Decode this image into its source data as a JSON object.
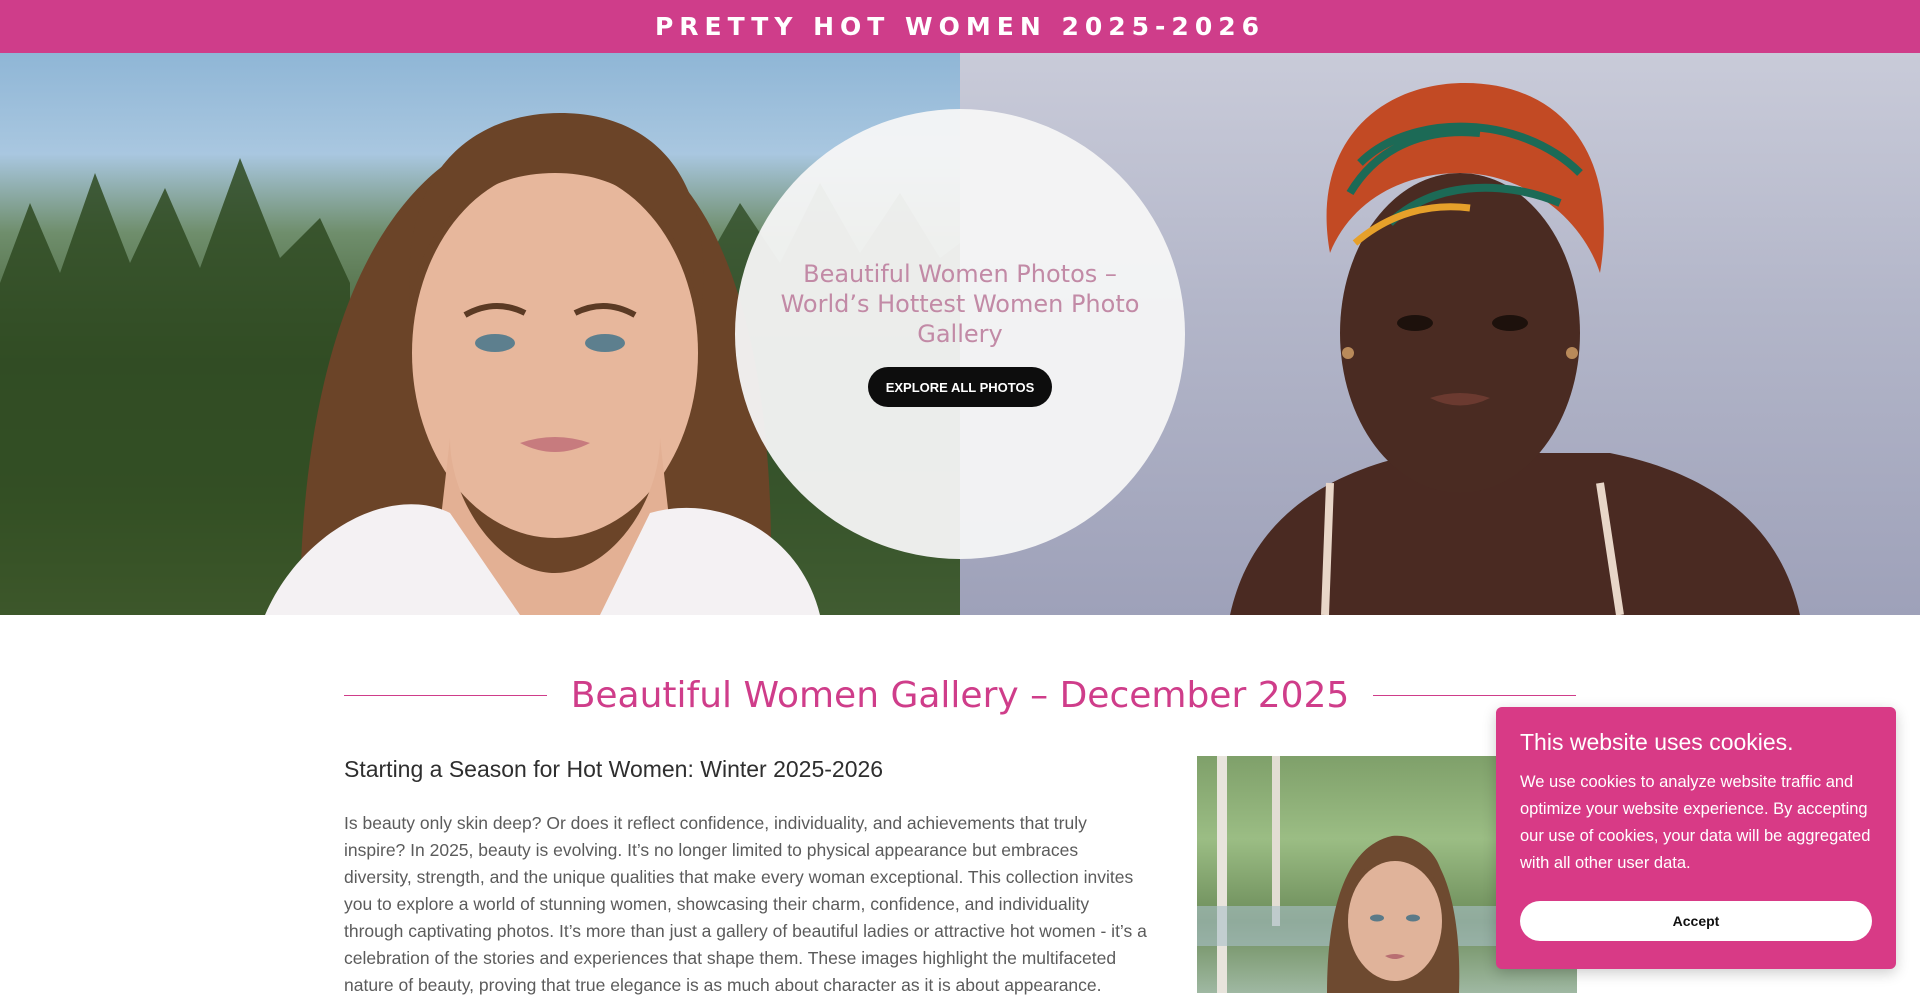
{
  "header": {
    "site_title": "PRETTY HOT WOMEN 2025-2026"
  },
  "hero": {
    "heading": "Beautiful Women Photos – World’s Hottest Women Photo Gallery",
    "cta_label": "EXPLORE ALL PHOTOS",
    "left_photo_icon": "woman-portrait-forest-photo",
    "right_photo_icon": "woman-portrait-headwrap-photo"
  },
  "main": {
    "section_title": "Beautiful Women Gallery – December 2025",
    "subheading": "Starting a Season for Hot Women: Winter 2025-2026",
    "paragraph": "Is beauty only skin deep? Or does it reflect confidence, individuality, and achievements that truly inspire? In 2025, beauty is evolving. It’s no longer limited to physical appearance but embraces diversity, strength, and the unique qualities that make every woman exceptional. This collection invites you to explore a world of stunning women, showcasing their charm, confidence, and individuality through captivating photos. It’s more than just a gallery of beautiful ladies or attractive hot women - it’s a celebration of the stories and experiences that shape them. These images highlight the multifaceted nature of beauty, proving that true elegance is as much about character as it is about appearance.",
    "side_photo_icon": "woman-portrait-birch-lake-photo"
  },
  "cookie_banner": {
    "title": "This website uses cookies.",
    "text": "We use cookies to analyze website traffic and optimize your website experience. By accepting our use of cookies, your data will be aggregated with all other user data.",
    "accept_label": "Accept"
  },
  "colors": {
    "brand_pink": "#cf3d8a",
    "cookie_pink": "#d83a86",
    "button_black": "#0d0d0d"
  }
}
